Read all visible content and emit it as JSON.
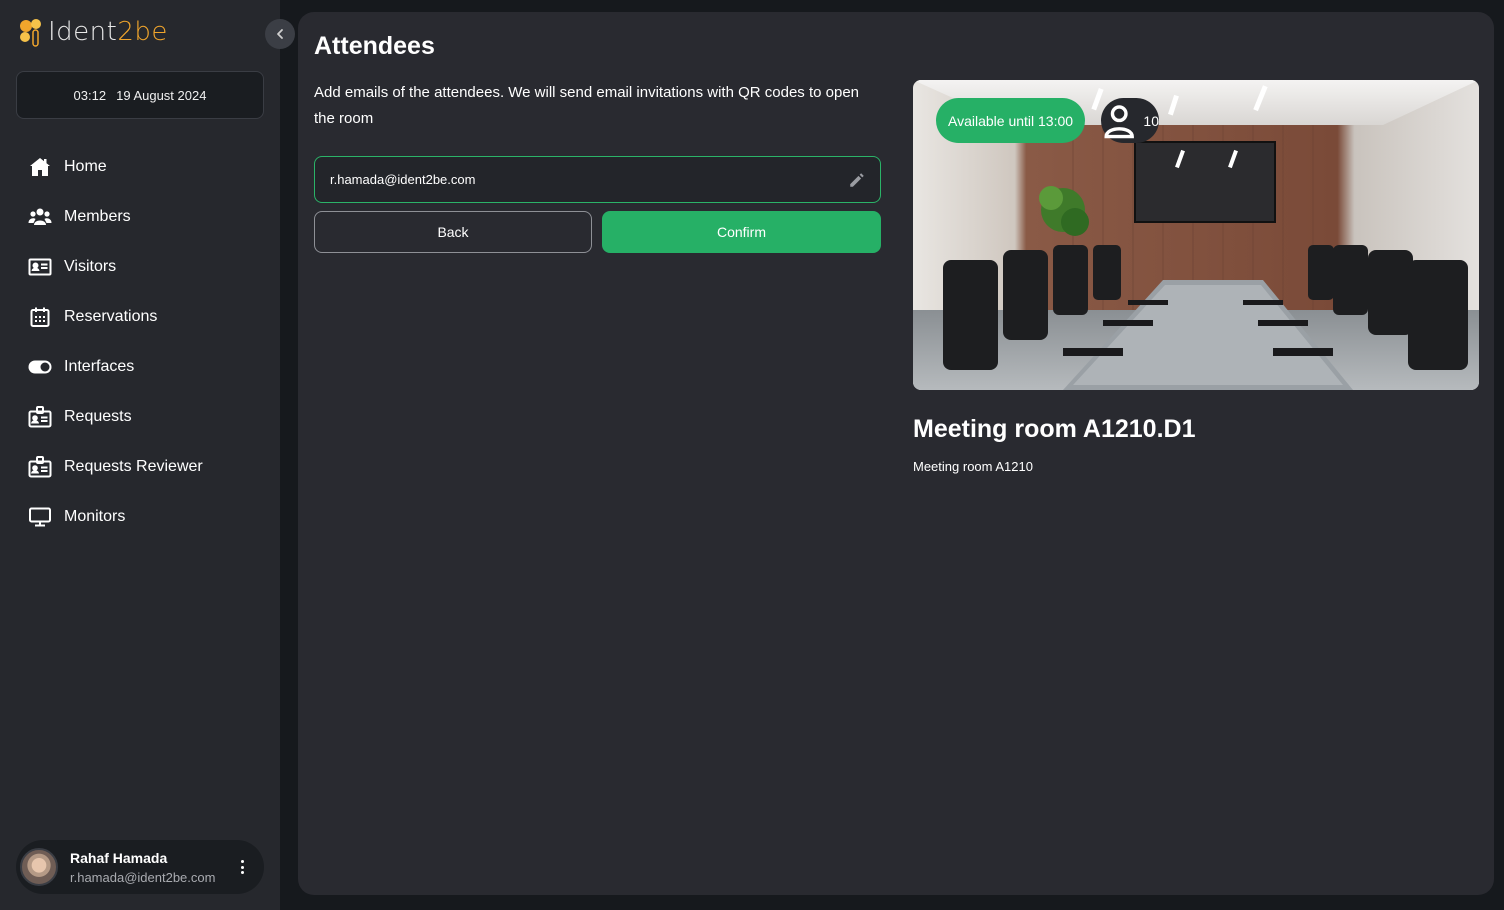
{
  "brand": {
    "logo_text_primary": "Ident",
    "logo_text_accent": "2be",
    "accent_color": "#f0a52c"
  },
  "datetime": {
    "time": "03:12",
    "date": "19 August 2024"
  },
  "sidebar": {
    "collapse_icon": "chevron-left-icon",
    "items": [
      {
        "label": "Home",
        "icon": "home-icon"
      },
      {
        "label": "Members",
        "icon": "users-icon"
      },
      {
        "label": "Visitors",
        "icon": "id-card-icon"
      },
      {
        "label": "Reservations",
        "icon": "calendar-icon"
      },
      {
        "label": "Interfaces",
        "icon": "toggle-icon"
      },
      {
        "label": "Requests",
        "icon": "badge-icon"
      },
      {
        "label": "Requests Reviewer",
        "icon": "badge-icon"
      },
      {
        "label": "Monitors",
        "icon": "monitor-icon"
      }
    ]
  },
  "user": {
    "name": "Rahaf Hamada",
    "email": "r.hamada@ident2be.com"
  },
  "page": {
    "title": "Attendees",
    "description": "Add emails of the attendees. We will send email invitations with QR codes to open the room",
    "email_value": "r.hamada@ident2be.com",
    "back_label": "Back",
    "confirm_label": "Confirm"
  },
  "room": {
    "availability": "Available until 13:00",
    "capacity": "10",
    "title": "Meeting room A1210.D1",
    "subtitle": "Meeting room A1210"
  },
  "colors": {
    "primary_green": "#26b066",
    "sidebar_bg": "#26282d",
    "main_bg": "#292a30",
    "page_bg": "#16191d"
  }
}
